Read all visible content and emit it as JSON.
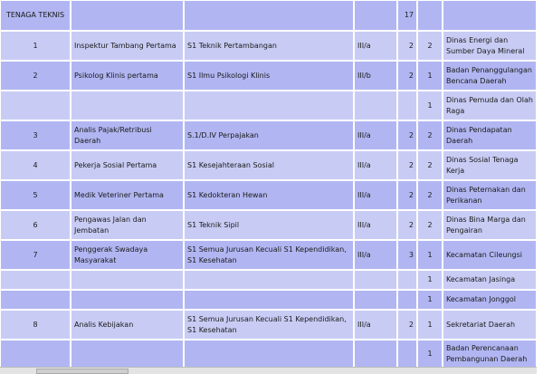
{
  "table": {
    "header": {
      "label": "TENAGA TEKNIS",
      "total": "17"
    },
    "rows": [
      {
        "no": "1",
        "jabatan": "Inspektur Tambang Pertama",
        "kualifikasi": "S1 Teknik Pertambangan",
        "golongan": "III/a",
        "jumlah": "2",
        "alokasi": "2",
        "unit": "Dinas Energi dan Sumber Daya Mineral"
      },
      {
        "no": "2",
        "jabatan": "Psikolog Klinis pertama",
        "kualifikasi": "S1 Ilmu Psikologi Klinis",
        "golongan": "III/b",
        "jumlah": "2",
        "alokasi": "1",
        "unit": "Badan Penanggulangan Bencana Daerah"
      },
      {
        "no": "",
        "jabatan": "",
        "kualifikasi": "",
        "golongan": "",
        "jumlah": "",
        "alokasi": "1",
        "unit": "Dinas Pemuda dan Olah Raga"
      },
      {
        "no": "3",
        "jabatan": "Analis Pajak/Retribusi Daerah",
        "kualifikasi": "S.1/D.IV Perpajakan",
        "golongan": "III/a",
        "jumlah": "2",
        "alokasi": "2",
        "unit": "Dinas Pendapatan Daerah"
      },
      {
        "no": "4",
        "jabatan": "Pekerja Sosial Pertama",
        "kualifikasi": "S1 Kesejahteraan Sosial",
        "golongan": "III/a",
        "jumlah": "2",
        "alokasi": "2",
        "unit": "Dinas Sosial Tenaga Kerja"
      },
      {
        "no": "5",
        "jabatan": "Medik Veteriner Pertama",
        "kualifikasi": "S1 Kedokteran Hewan",
        "golongan": "III/a",
        "jumlah": "2",
        "alokasi": "2",
        "unit": "Dinas Peternakan dan Perikanan"
      },
      {
        "no": "6",
        "jabatan": "Pengawas Jalan dan Jembatan",
        "kualifikasi": "S1 Teknik Sipil",
        "golongan": "III/a",
        "jumlah": "2",
        "alokasi": "2",
        "unit": "Dinas Bina Marga dan Pengairan"
      },
      {
        "no": "7",
        "jabatan": "Penggerak Swadaya Masyarakat",
        "kualifikasi": "S1 Semua Jurusan Kecuali S1 Kependidikan, S1 Kesehatan",
        "golongan": "III/a",
        "jumlah": "3",
        "alokasi": "1",
        "unit": "Kecamatan Cileungsi"
      },
      {
        "no": "",
        "jabatan": "",
        "kualifikasi": "",
        "golongan": "",
        "jumlah": "",
        "alokasi": "1",
        "unit": "Kecamatan Jasinga"
      },
      {
        "no": "",
        "jabatan": "",
        "kualifikasi": "",
        "golongan": "",
        "jumlah": "",
        "alokasi": "1",
        "unit": "Kecamatan Jonggol"
      },
      {
        "no": "8",
        "jabatan": "Analis Kebijakan",
        "kualifikasi": "S1 Semua Jurusan Kecuali S1 Kependidikan, S1 Kesehatan",
        "golongan": "III/a",
        "jumlah": "2",
        "alokasi": "1",
        "unit": "Sekretariat Daerah"
      },
      {
        "no": "",
        "jabatan": "",
        "kualifikasi": "",
        "golongan": "",
        "jumlah": "",
        "alokasi": "1",
        "unit": "Badan Perencanaan Pembangunan Daerah"
      }
    ]
  }
}
